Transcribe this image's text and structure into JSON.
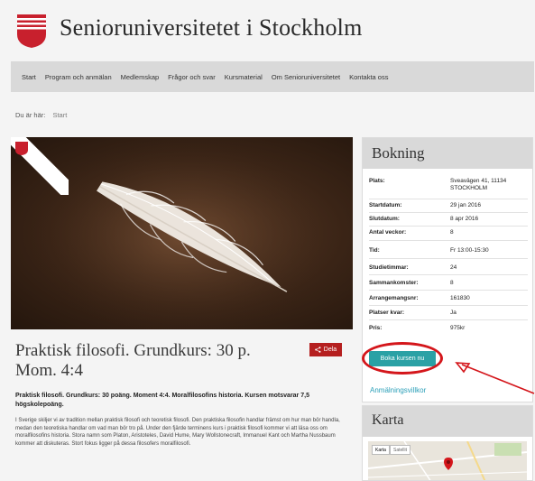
{
  "header": {
    "title": "Senioruniversitetet i Stockholm"
  },
  "nav": {
    "items": [
      "Start",
      "Program och anmälan",
      "Medlemskap",
      "Frågor och svar",
      "Kursmaterial",
      "Om Senioruniversitetet",
      "Kontakta oss"
    ]
  },
  "breadcrumb": {
    "prefix": "Du är här:",
    "current": "Start"
  },
  "course": {
    "title": "Praktisk filosofi. Grundkurs: 30 p. Mom. 4:4",
    "subtitle": "Praktisk filosofi. Grundkurs: 30 poäng. Moment 4:4. Moralfilosofins historia. Kursen motsvarar 7,5 högskolepoäng.",
    "body": "I Sverige skiljer vi av tradition mellan praktisk filosofi och teoretisk filosofi. Den praktiska filosofin handlar främst om hur man bör handla, medan den teoretiska handlar om vad man bör tro på. Under den fjärde terminens kurs i praktisk filosofi kommer vi att läsa oss om moralfilosofins historia. Stora namn som Platon, Aristoteles, David Hume, Mary Wollstonecraft, Immanuel Kant och Martha Nussbaum kommer att diskuteras. Stort fokus ligger på dessa filosofers moralfilosofi."
  },
  "share": {
    "label": "Dela"
  },
  "booking": {
    "title": "Bokning",
    "rows": [
      {
        "label": "Plats:",
        "value": "Sveavägen 41, 11134 STOCKHOLM"
      },
      {
        "label": "Startdatum:",
        "value": "29 jan 2016"
      },
      {
        "label": "Slutdatum:",
        "value": "8 apr 2016"
      },
      {
        "label": "Antal veckor:",
        "value": "8"
      },
      {
        "label": "Tid:",
        "value": "Fr 13:00-15:30"
      },
      {
        "label": "Studietimmar:",
        "value": "24"
      },
      {
        "label": "Sammankomster:",
        "value": "8"
      },
      {
        "label": "Arrangemangsnr:",
        "value": "161830"
      },
      {
        "label": "Platser kvar:",
        "value": "Ja"
      },
      {
        "label": "Pris:",
        "value": "975kr"
      }
    ],
    "button": "Boka kursen nu",
    "terms": "Anmälningsvillkor"
  },
  "map": {
    "title": "Karta",
    "tabs": [
      "Karta",
      "Satellit"
    ]
  },
  "colors": {
    "accent": "#2aa1a5",
    "brand": "#c8202d",
    "share": "#b51f1f",
    "annotation": "#d4161b"
  }
}
